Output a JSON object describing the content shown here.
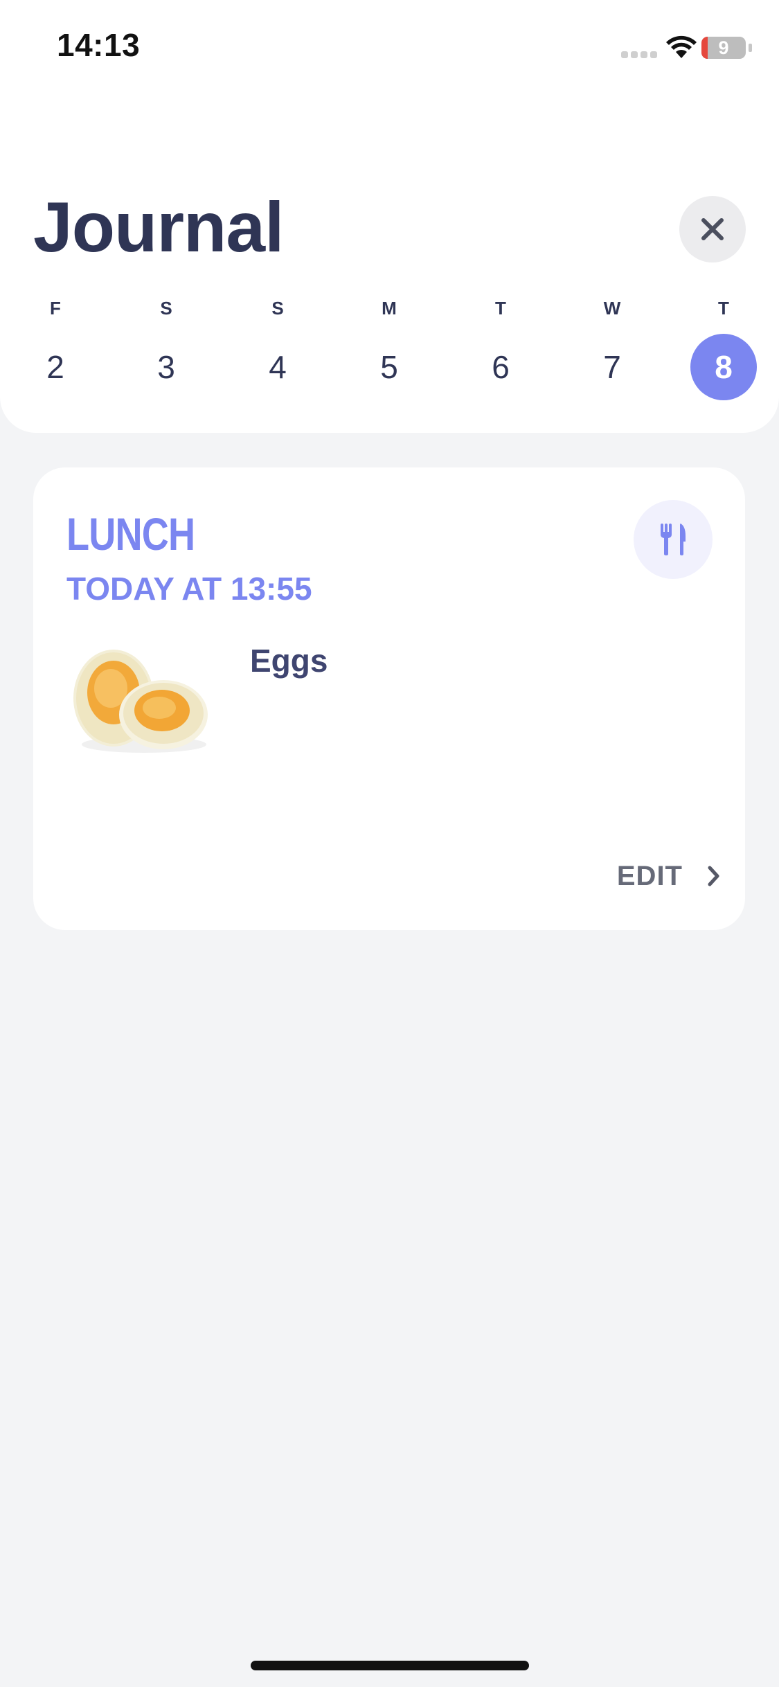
{
  "status_bar": {
    "time": "14:13",
    "battery_level": "9"
  },
  "header": {
    "title": "Journal"
  },
  "week": [
    {
      "letter": "F",
      "number": "2",
      "selected": false
    },
    {
      "letter": "S",
      "number": "3",
      "selected": false
    },
    {
      "letter": "S",
      "number": "4",
      "selected": false
    },
    {
      "letter": "M",
      "number": "5",
      "selected": false
    },
    {
      "letter": "T",
      "number": "6",
      "selected": false
    },
    {
      "letter": "W",
      "number": "7",
      "selected": false
    },
    {
      "letter": "T",
      "number": "8",
      "selected": true
    }
  ],
  "meal": {
    "title": "LUNCH",
    "time": "TODAY AT 13:55",
    "icon": "fork-knife-icon",
    "food_name": "Eggs",
    "food_image": "boiled-eggs-image",
    "edit_label": "EDIT"
  },
  "colors": {
    "accent": "#7b86f0",
    "title_text": "#2f3555",
    "background": "#f3f4f6"
  }
}
